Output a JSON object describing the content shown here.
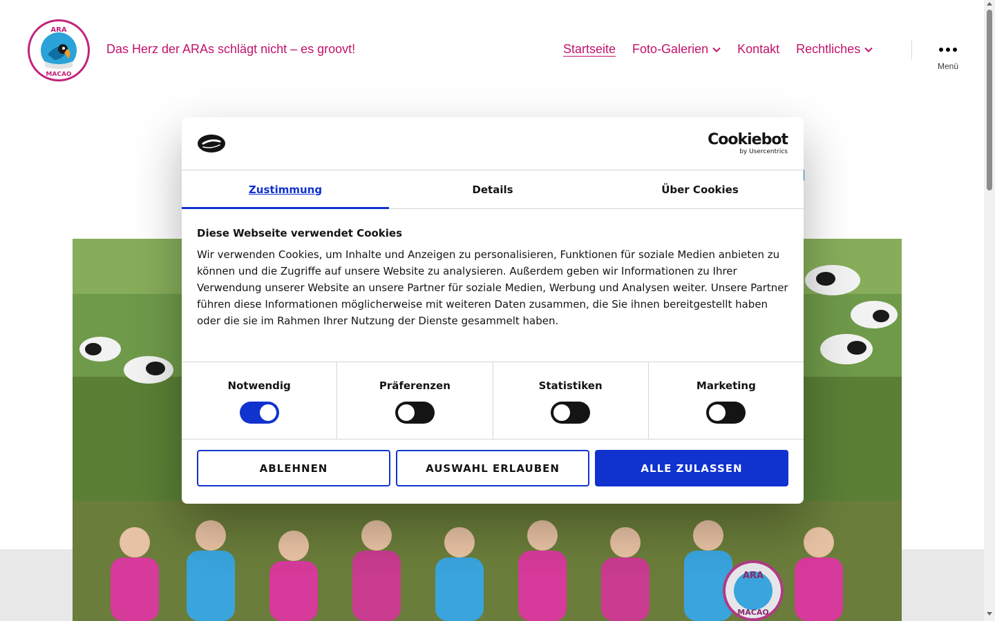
{
  "site": {
    "tagline": "Das Herz der ARAs schlägt nicht – es groovt!",
    "logo_text_top": "ARA",
    "logo_text_bottom": "MACAO"
  },
  "nav": {
    "items": [
      {
        "label": "Startseite",
        "active": true,
        "has_dropdown": false
      },
      {
        "label": "Foto-Galerien",
        "active": false,
        "has_dropdown": true
      },
      {
        "label": "Kontakt",
        "active": false,
        "has_dropdown": false
      },
      {
        "label": "Rechtliches",
        "active": false,
        "has_dropdown": true
      }
    ],
    "menu_label": "Menü"
  },
  "cookie_dialog": {
    "brand_main": "Cookiebot",
    "brand_sub": "by Usercentrics",
    "tabs": [
      {
        "label": "Zustimmung",
        "active": true
      },
      {
        "label": "Details",
        "active": false
      },
      {
        "label": "Über Cookies",
        "active": false
      }
    ],
    "title": "Diese Webseite verwendet Cookies",
    "text": "Wir verwenden Cookies, um Inhalte und Anzeigen zu personalisieren, Funktionen für soziale Medien anbieten zu können und die Zugriffe auf unsere Website zu analysieren. Außerdem geben wir Informationen zu Ihrer Verwendung unserer Website an unsere Partner für soziale Medien, Werbung und Analysen weiter. Unsere Partner führen diese Informationen möglicherweise mit weiteren Daten zusammen, die Sie ihnen bereitgestellt haben oder die sie im Rahmen Ihrer Nutzung der Dienste gesammelt haben.",
    "toggles": [
      {
        "label": "Notwendig",
        "on": true
      },
      {
        "label": "Präferenzen",
        "on": false
      },
      {
        "label": "Statistiken",
        "on": false
      },
      {
        "label": "Marketing",
        "on": false
      }
    ],
    "buttons": {
      "decline": "ABLEHNEN",
      "allow_selection": "AUSWAHL ERLAUBEN",
      "allow_all": "ALLE ZULASSEN"
    }
  },
  "hero": {
    "drum_text_top": "ARA",
    "drum_text_bottom": "MACAO"
  },
  "colors": {
    "brand_pink": "#c2126b",
    "cookie_blue": "#1032cf"
  }
}
